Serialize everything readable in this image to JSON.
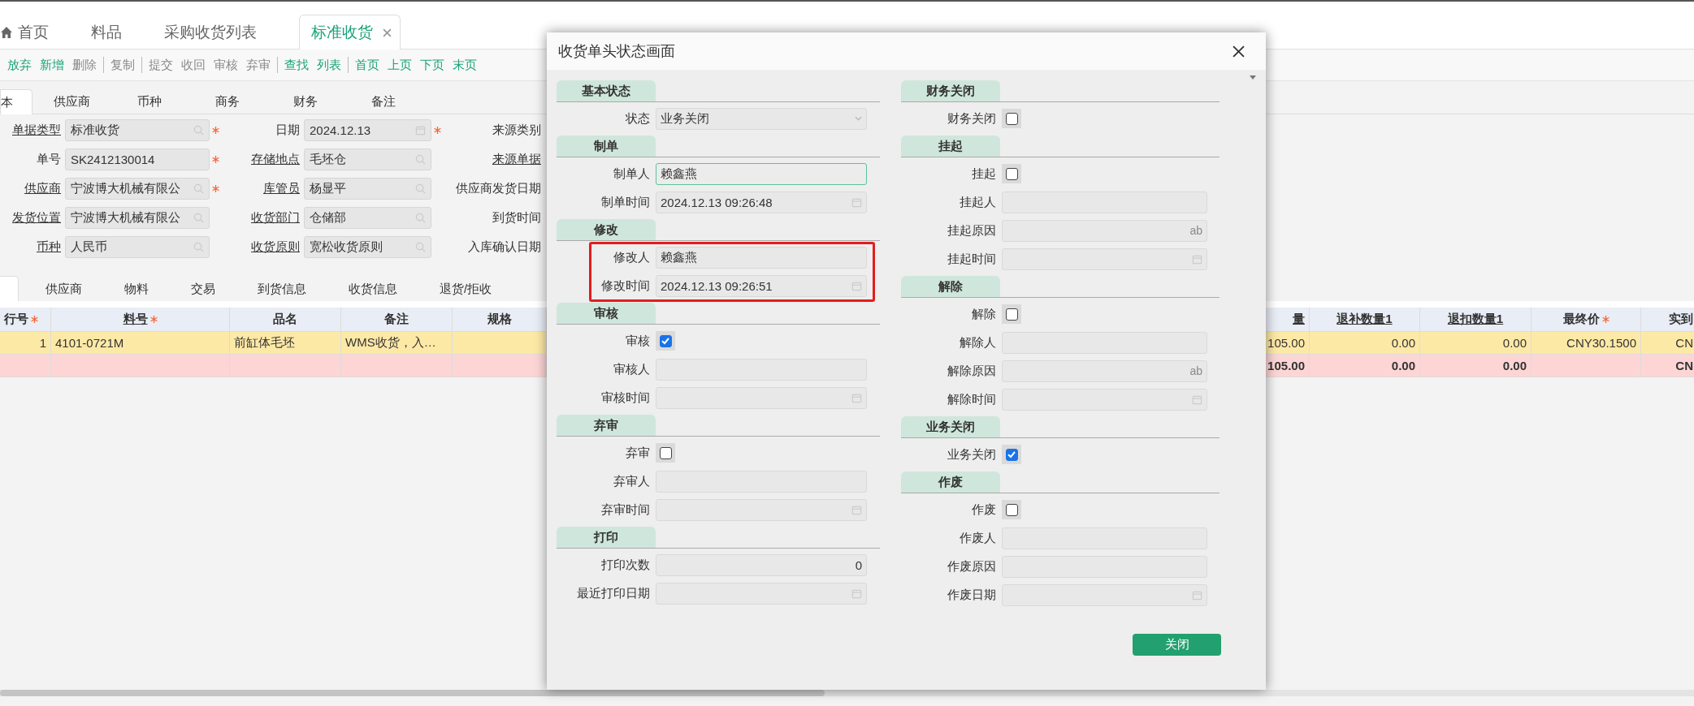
{
  "app_tabs": [
    {
      "label": "首页",
      "selected": false,
      "closable": false
    },
    {
      "label": "料品",
      "selected": false,
      "closable": false
    },
    {
      "label": "采购收货列表",
      "selected": false,
      "closable": false
    },
    {
      "label": "标准收货",
      "selected": true,
      "closable": true
    }
  ],
  "toolbar": [
    [
      {
        "label": "放弃",
        "disabled": false
      },
      {
        "label": "新增",
        "disabled": false
      },
      {
        "label": "删除",
        "disabled": true
      }
    ],
    [
      {
        "label": "复制",
        "disabled": true
      }
    ],
    [
      {
        "label": "提交",
        "disabled": true
      },
      {
        "label": "收回",
        "disabled": true
      },
      {
        "label": "审核",
        "disabled": true
      },
      {
        "label": "弃审",
        "disabled": true
      }
    ],
    [
      {
        "label": "查找",
        "disabled": false
      },
      {
        "label": "列表",
        "disabled": false
      }
    ],
    [
      {
        "label": "首页",
        "disabled": false
      },
      {
        "label": "上页",
        "disabled": false
      },
      {
        "label": "下页",
        "disabled": false
      },
      {
        "label": "末页",
        "disabled": false
      }
    ]
  ],
  "header_tabs": [
    {
      "label": "本",
      "selected": true
    },
    {
      "label": "供应商",
      "selected": false
    },
    {
      "label": "币种",
      "selected": false
    },
    {
      "label": "商务",
      "selected": false
    },
    {
      "label": "财务",
      "selected": false
    },
    {
      "label": "备注",
      "selected": false
    }
  ],
  "header_form": [
    [
      {
        "label": "单据类型",
        "linked": true,
        "value": "标准收货",
        "kind": "lookup",
        "required": true
      },
      {
        "label": "日期",
        "linked": false,
        "value": "2024.12.13",
        "kind": "date",
        "required": true
      },
      {
        "label": "来源类别",
        "linked": false
      }
    ],
    [
      {
        "label": "单号",
        "linked": false,
        "value": "SK2412130014",
        "kind": "text",
        "required": true
      },
      {
        "label": "存储地点",
        "linked": true,
        "value": "毛坯仓",
        "kind": "lookup",
        "required": false
      },
      {
        "label": "来源单据",
        "linked": true
      }
    ],
    [
      {
        "label": "供应商",
        "linked": true,
        "value": "宁波博大机械有限公",
        "kind": "lookup",
        "required": true
      },
      {
        "label": "库管员",
        "linked": true,
        "value": "杨显平",
        "kind": "lookup",
        "required": false
      },
      {
        "label": "供应商发货日期",
        "linked": false
      }
    ],
    [
      {
        "label": "发货位置",
        "linked": true,
        "value": "宁波博大机械有限公",
        "kind": "lookup",
        "required": false
      },
      {
        "label": "收货部门",
        "linked": true,
        "value": "仓储部",
        "kind": "lookup",
        "required": false
      },
      {
        "label": "到货时间",
        "linked": false
      }
    ],
    [
      {
        "label": "币种",
        "linked": true,
        "value": "人民币",
        "kind": "lookup",
        "required": false
      },
      {
        "label": "收货原则",
        "linked": true,
        "value": "宽松收货原则",
        "kind": "lookup",
        "required": false
      },
      {
        "label": "入库确认日期",
        "linked": false
      }
    ]
  ],
  "detail_tabs": [
    {
      "selected": true
    },
    {
      "label": "供应商",
      "selected": false
    },
    {
      "label": "物料",
      "selected": false
    },
    {
      "label": "交易",
      "selected": false
    },
    {
      "label": "到货信息",
      "selected": false
    },
    {
      "label": "收货信息",
      "selected": false
    },
    {
      "label": "退货/拒收",
      "selected": false
    }
  ],
  "grid": {
    "left_columns": [
      {
        "label": "行号",
        "required": true,
        "linked": false
      },
      {
        "label": "料号",
        "required": true,
        "linked": true
      },
      {
        "label": "品名",
        "required": false,
        "linked": false
      },
      {
        "label": "备注",
        "required": false,
        "linked": false
      },
      {
        "label": "规格",
        "required": false,
        "linked": false
      }
    ],
    "right_columns": [
      {
        "label": "量",
        "required": false,
        "linked": true
      },
      {
        "label": "退补数量1",
        "required": false,
        "linked": true
      },
      {
        "label": "退扣数量1",
        "required": false,
        "linked": true
      },
      {
        "label": "最终价",
        "required": true,
        "linked": false
      },
      {
        "label": "实到",
        "required": false,
        "linked": false
      }
    ],
    "rows": [
      {
        "kind": "data",
        "left": {
          "c0": "1",
          "c1": "4101-0721M",
          "c2": "前缸体毛坯",
          "c3": "WMS收货，入…"
        },
        "right": {
          "c0": "105.00",
          "c1": "0.00",
          "c2": "0.00",
          "c3": "CNY30.1500",
          "c4": "CN"
        }
      },
      {
        "kind": "total",
        "right": {
          "c0": "105.00",
          "c1": "0.00",
          "c2": "0.00",
          "c4": "CN"
        }
      }
    ]
  },
  "dialog": {
    "title": "收货单头状态画面",
    "left_sections": [
      {
        "title": "基本状态",
        "highlighted": false,
        "fields": [
          {
            "label": "状态",
            "kind": "select",
            "value": "业务关闭",
            "focused": false
          }
        ]
      },
      {
        "title": "制单",
        "highlighted": false,
        "fields": [
          {
            "label": "制单人",
            "kind": "text",
            "value": "赖鑫燕",
            "focused": true
          },
          {
            "label": "制单时间",
            "kind": "date",
            "value": "2024.12.13 09:26:48",
            "focused": false
          }
        ]
      },
      {
        "title": "修改",
        "highlighted": true,
        "fields": [
          {
            "label": "修改人",
            "kind": "text",
            "value": "赖鑫燕",
            "focused": false
          },
          {
            "label": "修改时间",
            "kind": "date",
            "value": "2024.12.13 09:26:51",
            "focused": false
          }
        ]
      },
      {
        "title": "审核",
        "highlighted": false,
        "fields": [
          {
            "label": "审核",
            "kind": "check",
            "checked": true
          },
          {
            "label": "审核人",
            "kind": "text",
            "focused": false
          },
          {
            "label": "审核时间",
            "kind": "date",
            "focused": false
          }
        ]
      },
      {
        "title": "弃审",
        "highlighted": false,
        "fields": [
          {
            "label": "弃审",
            "kind": "check",
            "checked": false
          },
          {
            "label": "弃审人",
            "kind": "text",
            "focused": false
          },
          {
            "label": "弃审时间",
            "kind": "date",
            "focused": false
          }
        ]
      },
      {
        "title": "打印",
        "highlighted": false,
        "fields": [
          {
            "label": "打印次数",
            "kind": "number",
            "value": "0",
            "focused": false
          },
          {
            "label": "最近打印日期",
            "kind": "date",
            "focused": false
          }
        ]
      }
    ],
    "right_sections": [
      {
        "title": "财务关闭",
        "highlighted": false,
        "fields": [
          {
            "label": "财务关闭",
            "kind": "check",
            "checked": false
          }
        ]
      },
      {
        "title": "挂起",
        "highlighted": false,
        "fields": [
          {
            "label": "挂起",
            "kind": "check",
            "checked": false
          },
          {
            "label": "挂起人",
            "kind": "text",
            "focused": false
          },
          {
            "label": "挂起原因",
            "kind": "text",
            "suffix": "ab",
            "focused": false
          },
          {
            "label": "挂起时间",
            "kind": "date",
            "focused": false
          }
        ]
      },
      {
        "title": "解除",
        "highlighted": false,
        "fields": [
          {
            "label": "解除",
            "kind": "check",
            "checked": false
          },
          {
            "label": "解除人",
            "kind": "text",
            "focused": false
          },
          {
            "label": "解除原因",
            "kind": "text",
            "suffix": "ab",
            "focused": false
          },
          {
            "label": "解除时间",
            "kind": "date",
            "focused": false
          }
        ]
      },
      {
        "title": "业务关闭",
        "highlighted": false,
        "fields": [
          {
            "label": "业务关闭",
            "kind": "check",
            "checked": true
          }
        ]
      },
      {
        "title": "作废",
        "highlighted": false,
        "fields": [
          {
            "label": "作废",
            "kind": "check",
            "checked": false
          },
          {
            "label": "作废人",
            "kind": "text",
            "focused": false
          },
          {
            "label": "作废原因",
            "kind": "text",
            "focused": false
          },
          {
            "label": "作废日期",
            "kind": "date",
            "focused": false
          }
        ]
      }
    ],
    "close_button": "关闭"
  }
}
